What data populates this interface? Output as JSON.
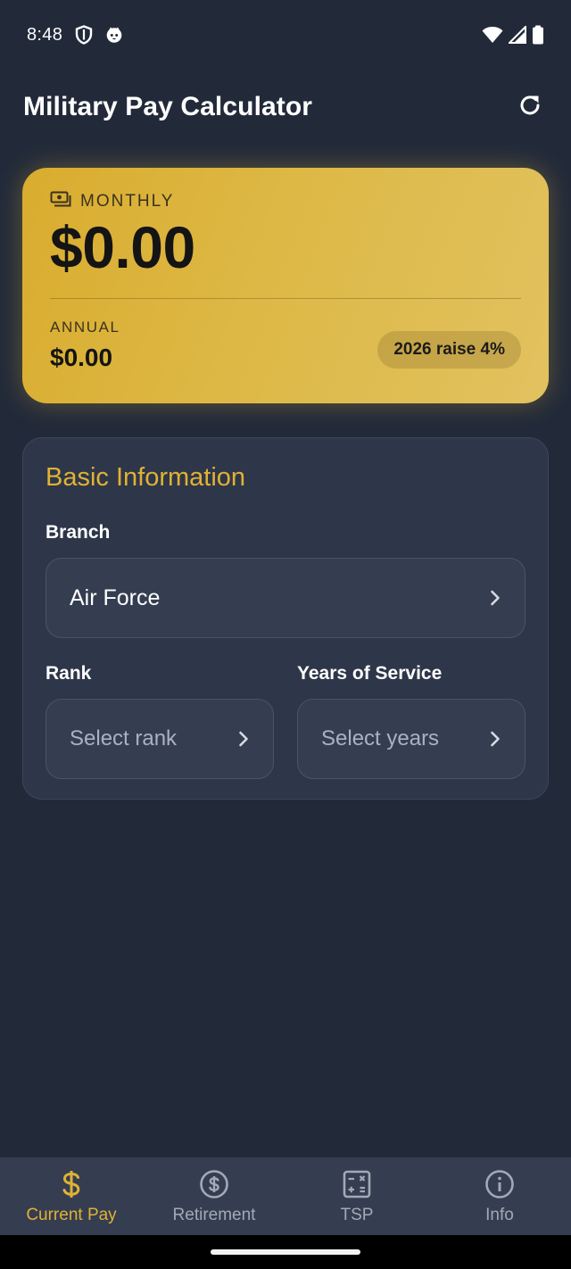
{
  "status_bar": {
    "time": "8:48",
    "icons": [
      "shield-icon",
      "cat-icon",
      "wifi-icon",
      "signal-icon",
      "battery-icon"
    ]
  },
  "app_bar": {
    "title": "Military Pay Calculator",
    "action_icon": "refresh-icon"
  },
  "pay_card": {
    "monthly_label": "MONTHLY",
    "monthly_value": "$0.00",
    "annual_label": "ANNUAL",
    "annual_value": "$0.00",
    "raise_badge": "2026 raise 4%",
    "colors": {
      "gradient_start": "#d9ac2e",
      "gradient_end": "#e2c260"
    }
  },
  "basic_info": {
    "title": "Basic Information",
    "branch": {
      "label": "Branch",
      "value": "Air Force"
    },
    "rank": {
      "label": "Rank",
      "placeholder": "Select rank"
    },
    "years": {
      "label": "Years of Service",
      "placeholder": "Select years"
    }
  },
  "bottom_nav": {
    "items": [
      {
        "label": "Current Pay",
        "icon": "dollar-icon",
        "active": true
      },
      {
        "label": "Retirement",
        "icon": "dollar-circle-icon",
        "active": false
      },
      {
        "label": "TSP",
        "icon": "calculator-icon",
        "active": false
      },
      {
        "label": "Info",
        "icon": "info-icon",
        "active": false
      }
    ]
  },
  "colors": {
    "background": "#222a3a",
    "card": "#2e3649",
    "accent": "#e0b234",
    "nav_background": "#353d51"
  }
}
